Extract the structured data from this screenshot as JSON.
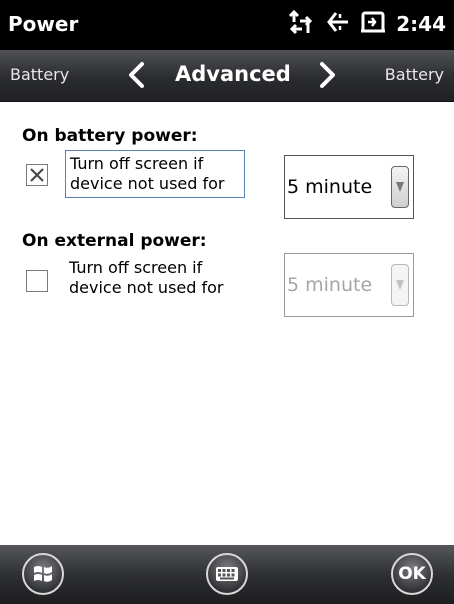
{
  "status_bar": {
    "title": "Power",
    "time": "2:44",
    "icons": [
      "connectivity-arrows-icon",
      "volume-icon",
      "battery-icon"
    ]
  },
  "tabs": {
    "previous": "Battery",
    "current": "Advanced",
    "next": "Battery"
  },
  "battery_power": {
    "heading": "On battery power:",
    "checked": true,
    "option_line1": "Turn off screen if",
    "option_line2": "device not used for",
    "timeout_value": "5 minute"
  },
  "external_power": {
    "heading": "On external power:",
    "checked": false,
    "option_line1": "Turn off screen if",
    "option_line2": "device not used for",
    "timeout_value": "5 minute"
  },
  "bottom_bar": {
    "ok_label": "OK"
  },
  "colors": {
    "status_bg": "#000000",
    "bar_gradient_top": "#4f5155",
    "bar_gradient_bottom": "#202124",
    "focus_border": "#5a7fb3",
    "disabled_text": "#a6a6a6"
  }
}
